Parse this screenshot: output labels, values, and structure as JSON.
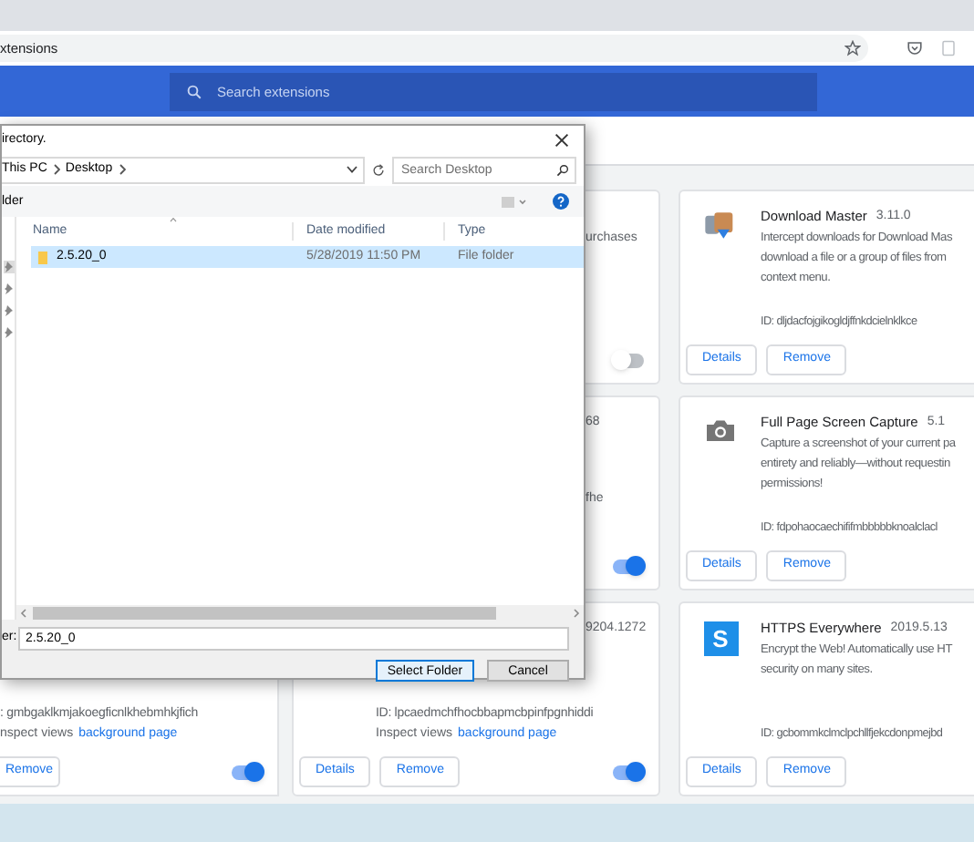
{
  "browser": {
    "url": "xtensions"
  },
  "header": {
    "search_placeholder": "Search extensions"
  },
  "dialog": {
    "title": "irectory.",
    "breadcrumb": [
      "This PC",
      "Desktop"
    ],
    "search_placeholder": "Search Desktop",
    "toolbar_button": "lder",
    "columns": [
      "Name",
      "Date modified",
      "Type"
    ],
    "rows": [
      {
        "name": "2.5.20_0",
        "date": "5/28/2019 11:50 PM",
        "type": "File folder",
        "selected": true
      }
    ],
    "field_label": "er:",
    "field_value": "2.5.20_0",
    "buttons": [
      "Select Folder",
      "Cancel"
    ]
  },
  "card_columns": [
    [
      {
        "id": ": gmbgaklkmjakoegficnlkhebmhkjfich",
        "inspect": "nspect views",
        "link": "background page",
        "buttons": [
          "Remove"
        ],
        "enabled": true
      }
    ],
    [
      {
        "desc_tail": "urchases",
        "enabled": false
      },
      {
        "title_tail": "68",
        "id_tail": "fhe",
        "enabled": true
      },
      {
        "title_tail": "9204.1272",
        "id": "ID: lpcaedmchfhocbbapmcbpinfpgnhiddi",
        "inspect": "Inspect views",
        "link": "background page",
        "buttons": [
          "Details",
          "Remove"
        ],
        "enabled": true
      }
    ],
    [
      {
        "kind": "download",
        "name": "Download Master",
        "version": "3.11.0",
        "description": [
          "Intercept downloads for Download Mas",
          "download a file or a group of files from",
          "context menu."
        ],
        "id": "ID: dljdacfojgikogldjffnkdcielnklkce",
        "buttons": [
          "Details",
          "Remove"
        ]
      },
      {
        "kind": "camera",
        "name": "Full Page Screen Capture",
        "version": "5.1",
        "description": [
          "Capture a screenshot of your current pa",
          "entirety and reliably—without requestin",
          "permissions!"
        ],
        "id": "ID: fdpohaocaechififmbbbbbknoalclacl",
        "buttons": [
          "Details",
          "Remove"
        ]
      },
      {
        "kind": "letter",
        "logo_letter": "S",
        "name": "HTTPS Everywhere",
        "version": "2019.5.13",
        "description": [
          "Encrypt the Web! Automatically use HT",
          "security on many sites."
        ],
        "id": "ID: gcbommkclmclpchllfjekcdonpmejbd",
        "buttons": [
          "Details",
          "Remove"
        ]
      }
    ]
  ]
}
